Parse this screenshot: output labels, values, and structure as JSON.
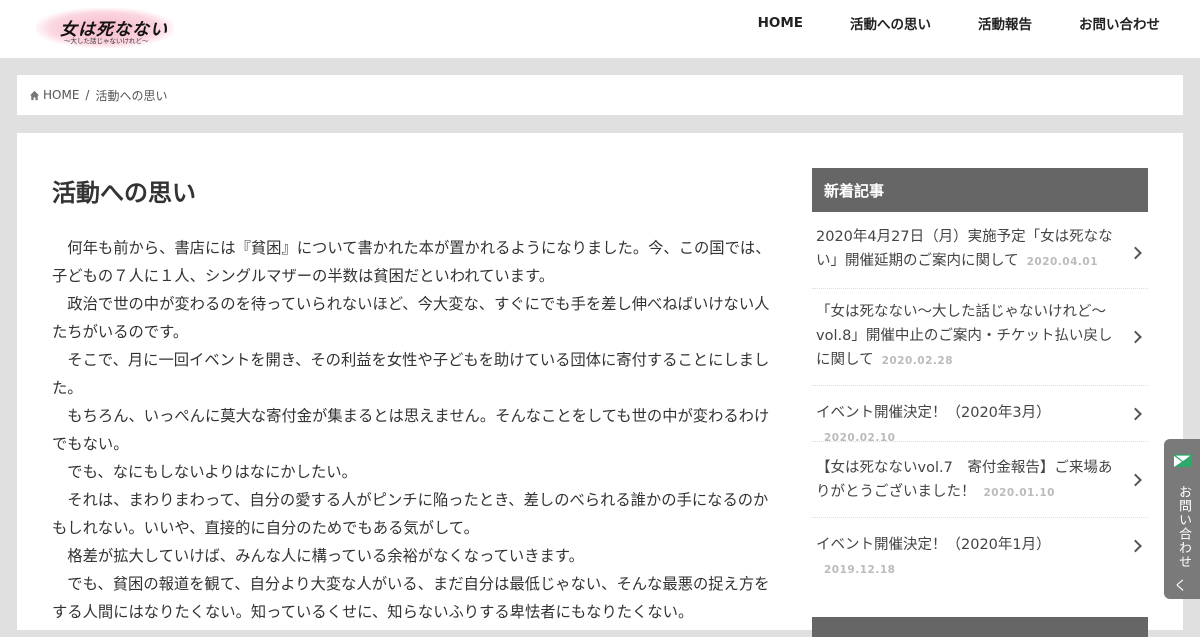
{
  "header": {
    "logo_text": "女は死なない",
    "logo_sub": "〜大した話じゃないけれど〜",
    "nav": [
      "HOME",
      "活動への思い",
      "活動報告",
      "お問い合わせ"
    ]
  },
  "breadcrumb": {
    "home": "HOME",
    "separator": "/",
    "current": "活動への思い"
  },
  "page": {
    "title": "活動への思い",
    "paragraphs": [
      "何年も前から、書店には『貧困』について書かれた本が置かれるようになりました。今、この国では、子どもの７人に１人、シングルマザーの半数は貧困だといわれています。",
      "政治で世の中が変わるのを待っていられないほど、今大変な、すぐにでも手を差し伸べねばいけない人たちがいるのです。",
      "そこで、月に一回イベントを開き、その利益を女性や子どもを助けている団体に寄付することにしました。",
      "もちろん、いっぺんに莫大な寄付金が集まるとは思えません。そんなことをしても世の中が変わるわけでもない。",
      "でも、なにもしないよりはなにかしたい。",
      "それは、まわりまわって、自分の愛する人がピンチに陥ったとき、差しのべられる誰かの手になるのかもしれない。いいや、直接的に自分のためでもある気がして。",
      "格差が拡大していけば、みんな人に構っている余裕がなくなっていきます。",
      "でも、貧困の報道を観て、自分より大変な人がいる、まだ自分は最低じゃない、そんな最悪の捉え方をする人間にはなりたくない。知っているくせに、知らないふりする卑怯者にもなりたくない。"
    ]
  },
  "sidebar": {
    "heading": "新着記事",
    "posts": [
      {
        "title": "2020年4月27日（月）実施予定「女は死なない」開催延期のご案内に関して",
        "date": "2020.04.01"
      },
      {
        "title": "「女は死なない〜大した話じゃないけれど〜vol.8」開催中止のご案内・チケット払い戻しに関して",
        "date": "2020.02.28"
      },
      {
        "title": "イベント開催決定！（2020年3月）",
        "date": "2020.02.10"
      },
      {
        "title": "【女は死なないvol.7　寄付金報告】ご来場ありがとうございました！",
        "date": "2020.01.10"
      },
      {
        "title": "イベント開催決定！（2020年1月）",
        "date": "2019.12.18"
      }
    ]
  },
  "contact_tab": {
    "label": "お問い合わせ",
    "arrow": "く"
  },
  "colors": {
    "accent_gray": "#666666",
    "background": "#e0e0e0",
    "logo_pink": "#f6b9c8"
  }
}
